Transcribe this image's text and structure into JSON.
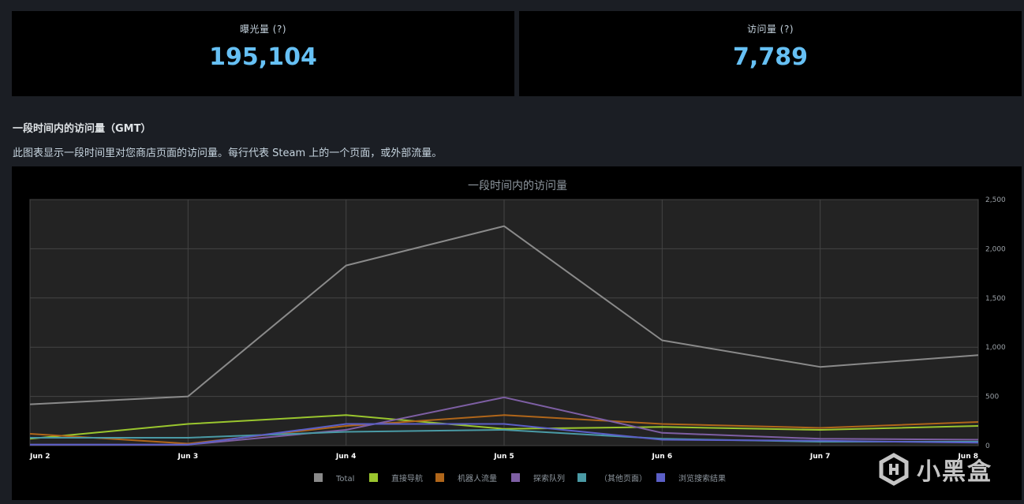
{
  "stats": [
    {
      "label": "曝光量 (?)",
      "value": "195,104"
    },
    {
      "label": "访问量 (?)",
      "value": "7,789"
    }
  ],
  "section": {
    "title": "一段时间内的访问量（GMT）",
    "description": "此图表显示一段时间里对您商店页面的访问量。每行代表 Steam 上的一个页面，或外部流量。"
  },
  "watermark": {
    "text": "小黑盒"
  },
  "chart_data": {
    "type": "line",
    "title": "一段时间内的访问量",
    "categories": [
      "Jun 2",
      "Jun 3",
      "Jun 4",
      "Jun 5",
      "Jun 6",
      "Jun 7",
      "Jun 8"
    ],
    "ylim": [
      0,
      2500
    ],
    "yticks": [
      0,
      500,
      1000,
      1500,
      2000,
      2500
    ],
    "ytick_labels": [
      "0",
      "500",
      "1,000",
      "1,500",
      "2,000",
      "2,500"
    ],
    "grid": true,
    "legend_position": "bottom",
    "series": [
      {
        "name": "Total",
        "color": "#8a8a8a",
        "values": [
          420,
          500,
          1830,
          2230,
          1070,
          800,
          920
        ]
      },
      {
        "name": "直接导航",
        "color": "#9ac62e",
        "values": [
          70,
          220,
          310,
          170,
          190,
          160,
          200
        ]
      },
      {
        "name": "机器人流量",
        "color": "#b0661a",
        "values": [
          120,
          20,
          200,
          310,
          220,
          180,
          240
        ]
      },
      {
        "name": "探索队列",
        "color": "#7e5fa4",
        "values": [
          10,
          10,
          160,
          490,
          130,
          70,
          60
        ]
      },
      {
        "name": "（其他页面）",
        "color": "#4a9aa5",
        "values": [
          80,
          80,
          140,
          160,
          70,
          40,
          40
        ]
      },
      {
        "name": "浏览搜索结果",
        "color": "#5b5fc7",
        "values": [
          10,
          10,
          220,
          220,
          60,
          50,
          30
        ]
      }
    ]
  }
}
